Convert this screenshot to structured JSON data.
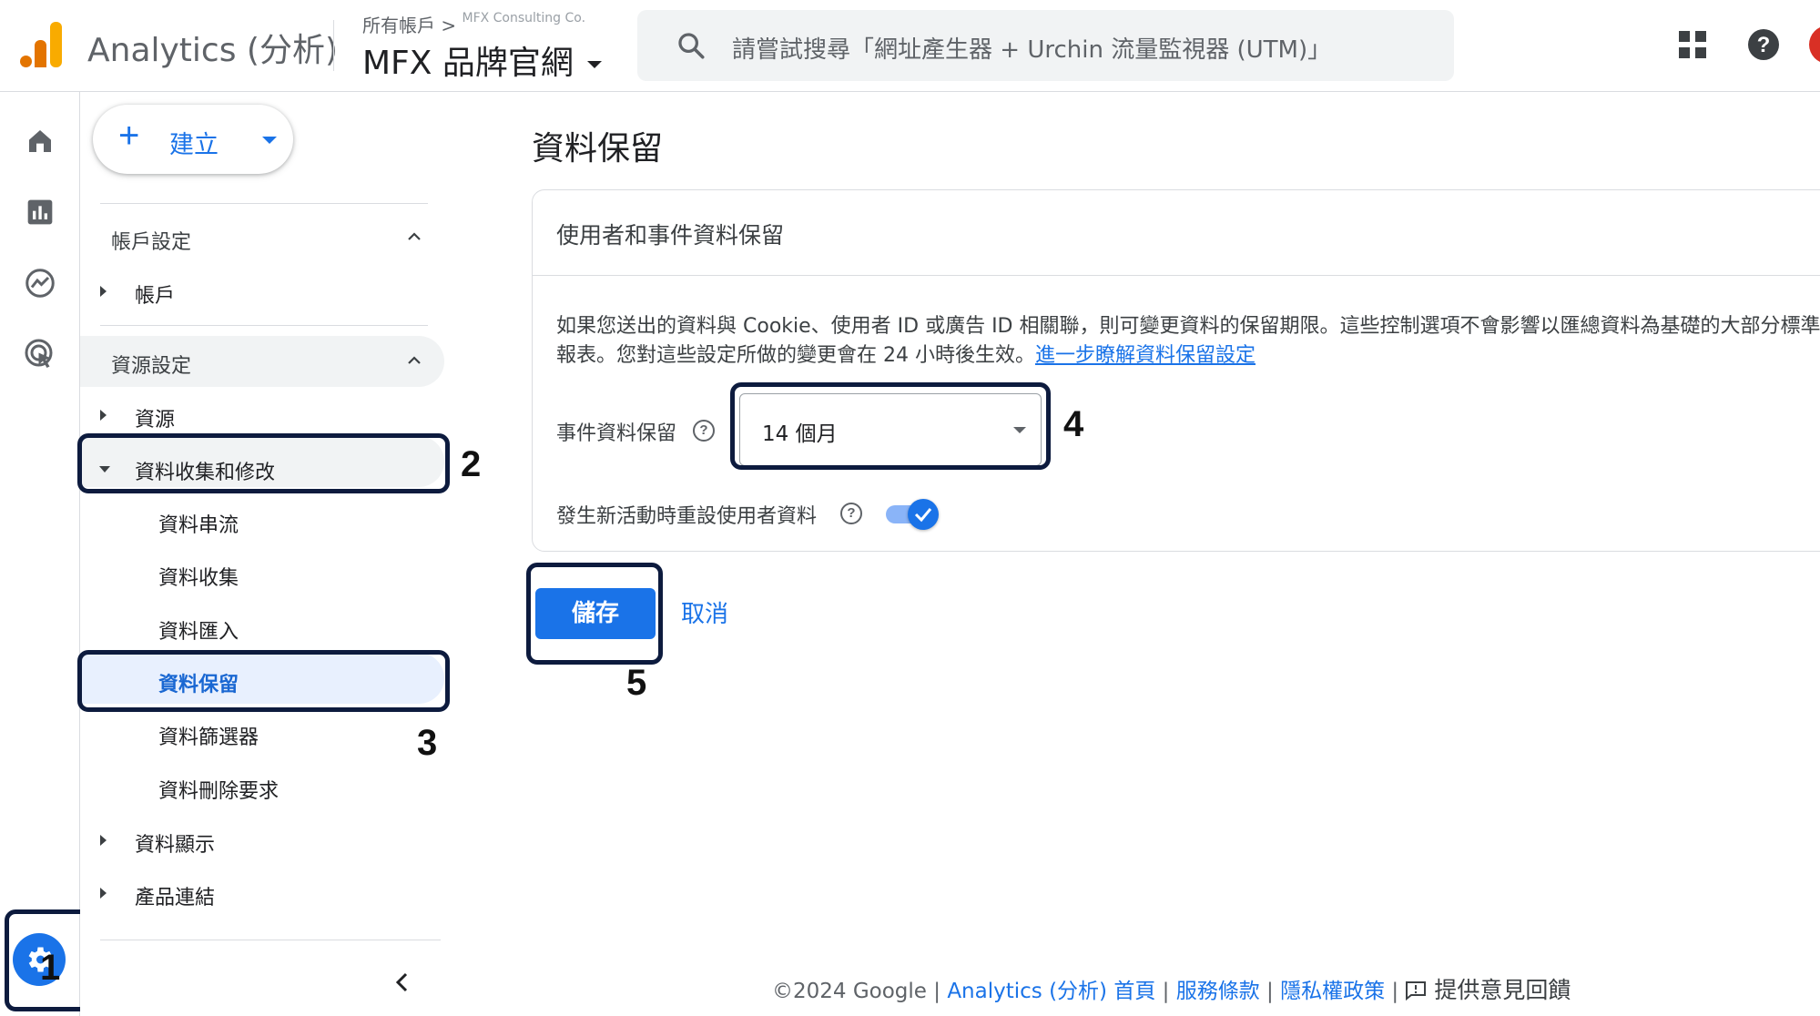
{
  "header": {
    "app_title": "Analytics (分析)",
    "breadcrumb": "所有帳戶 >",
    "breadcrumb_account": "MFX Consulting Co.",
    "property_name": "MFX 品牌官網",
    "search_placeholder": "請嘗試搜尋「網址產生器 + Urchin 流量監視器 (UTM)」"
  },
  "rail": {
    "icons": [
      "home-icon",
      "reports-icon",
      "explore-icon",
      "advertising-icon"
    ],
    "admin_icon": "gear-icon"
  },
  "sidebar": {
    "create_label": "建立",
    "account_section": "帳戶設定",
    "account_item": "帳戶",
    "property_section": "資源設定",
    "property_item": "資源",
    "data_collection": "資料收集和修改",
    "sub_items": [
      "資料串流",
      "資料收集",
      "資料匯入",
      "資料保留",
      "資料篩選器",
      "資料刪除要求"
    ],
    "data_display": "資料顯示",
    "product_links": "產品連結",
    "selected_item": "資料保留"
  },
  "annotations": [
    "1",
    "2",
    "3",
    "4",
    "5"
  ],
  "main": {
    "page_title": "資料保留",
    "card_title": "使用者和事件資料保留",
    "description": "如果您送出的資料與 Cookie、使用者 ID 或廣告 ID 相關聯，則可變更資料的保留期限。這些控制選項不會影響以匯總資料為基礎的大部分標準報表。您對這些設定所做的變更會在 24 小時後生效。",
    "learn_more_link": "進一步瞭解資料保留設定",
    "event_retention_label": "事件資料保留",
    "event_retention_value": "14 個月",
    "reset_label": "發生新活動時重設使用者資料",
    "reset_enabled": true,
    "save_label": "儲存",
    "cancel_label": "取消"
  },
  "footer": {
    "copyright": "©2024 Google |",
    "home_link": "Analytics (分析) 首頁",
    "sep": "|",
    "terms_link": "服務條款",
    "privacy_link": "隱私權政策",
    "feedback": "提供意見回饋"
  },
  "colors": {
    "accent": "#1a73e8",
    "annotation_box": "#0d1b3e",
    "selected_bg": "#e8f0fe",
    "logo_orange": "#f9ab00",
    "logo_dark_orange": "#e37400"
  }
}
